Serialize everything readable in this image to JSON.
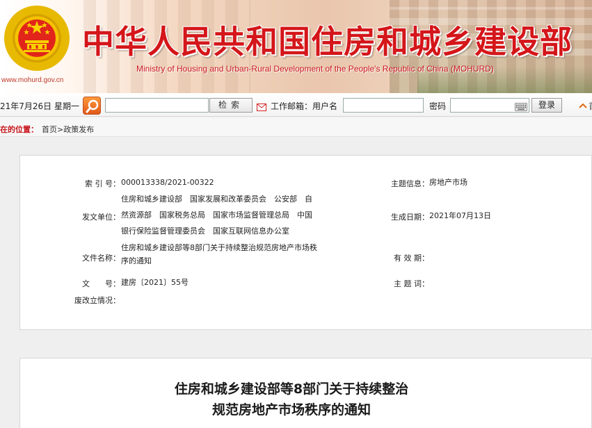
{
  "header": {
    "site_url": "www.mohurd.gov.cn",
    "ministry_cn": "中华人民共和国住房和城乡建设部",
    "ministry_en": "Ministry of Housing and Urban-Rural Development of the People's Republic of China (MOHURD)"
  },
  "toolbar": {
    "date": "21年7月26日 星期一",
    "search_placeholder": "",
    "search_button": "检索",
    "mailbox_label": "工作邮箱：用户名",
    "username_value": "",
    "password_label": "密码",
    "password_value": "",
    "login_button": "登录",
    "home_label": "首"
  },
  "breadcrumb": {
    "label": "在的位置：",
    "path": "首页>政策发布"
  },
  "meta": {
    "index_label": "索 引 号：",
    "index_value": "000013338/2021-00322",
    "topic_label": "主题信息：",
    "topic_value": "房地产市场",
    "issuer_label": "发文单位：",
    "issuer_value_1": "住房和城乡建设部　国家发展和改革委员会　公安部　自",
    "issuer_value_2": "然资源部　国家税务总局　国家市场监督管理总局　中国",
    "issuer_value_3": "银行保险监督管理委员会　国家互联网信息办公室",
    "created_label": "生成日期：",
    "created_value": "2021年07月13日",
    "docname_label": "文件名称：",
    "docname_value_1": "住房和城乡建设部等8部门关于持续整治规范房地产市场秩",
    "docname_value_2": "序的通知",
    "validity_label": "有 效 期：",
    "validity_value": "",
    "docno_label": "文　　号：",
    "docno_value": "建房〔2021〕55号",
    "keywords_label": "主 题 词：",
    "keywords_value": "",
    "status_label": "废改立情况：",
    "status_value": ""
  },
  "article": {
    "title_line1": "住房和城乡建设部等8部门关于持续整治",
    "title_line2": "规范房地产市场秩序的通知"
  },
  "colors": {
    "brand_red": "#d4161a",
    "search_orange": "#e0581a"
  }
}
